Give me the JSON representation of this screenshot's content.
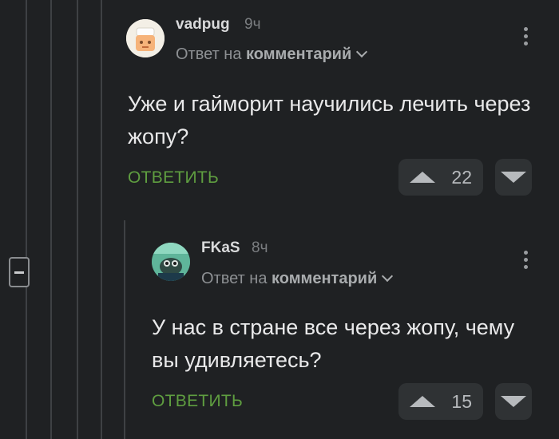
{
  "comments": [
    {
      "username": "vadpug",
      "time": "9ч",
      "reply_prefix": "Ответ на",
      "reply_target": "комментарий",
      "text": "Уже и гайморит научились лечить через жопу?",
      "reply_label": "ОТВЕТИТЬ",
      "upvotes": "22"
    },
    {
      "username": "FKaS",
      "time": "8ч",
      "reply_prefix": "Ответ на",
      "reply_target": "комментарий",
      "text": "У нас в стране все через жопу, чему вы удивляетесь?",
      "reply_label": "ОТВЕТИТЬ",
      "upvotes": "15"
    }
  ],
  "icons": {
    "collapse": "minus-square-icon",
    "more": "kebab-icon",
    "up": "arrow-up-icon",
    "down": "arrow-down-icon"
  },
  "colors": {
    "background": "#1f2123",
    "reply_green": "#5f9e40",
    "button_bg": "#2f3234"
  }
}
